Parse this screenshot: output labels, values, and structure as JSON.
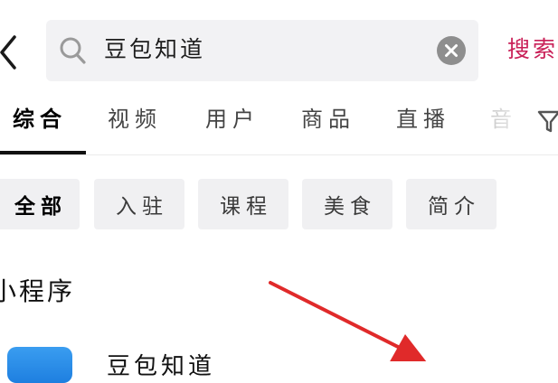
{
  "search": {
    "query": "豆包知道",
    "submit_label": "搜索"
  },
  "tabs": [
    {
      "label": "综合",
      "active": true
    },
    {
      "label": "视频",
      "active": false
    },
    {
      "label": "用户",
      "active": false
    },
    {
      "label": "商品",
      "active": false
    },
    {
      "label": "直播",
      "active": false
    },
    {
      "label": "音",
      "active": false
    }
  ],
  "filters": [
    {
      "label": "全部",
      "active": true
    },
    {
      "label": "入驻",
      "active": false
    },
    {
      "label": "课程",
      "active": false
    },
    {
      "label": "美食",
      "active": false
    },
    {
      "label": "简介",
      "active": false
    }
  ],
  "section": {
    "title": "小程序"
  },
  "result": {
    "title": "豆包知道"
  },
  "colors": {
    "accent": "#c91f57",
    "arrow": "#e02a2a",
    "chip_bg": "#f0f0f2",
    "search_bg": "#f2f2f4"
  },
  "icons": [
    "back-arrow-icon",
    "search-icon",
    "close-icon",
    "filter-icon",
    "app-icon"
  ]
}
